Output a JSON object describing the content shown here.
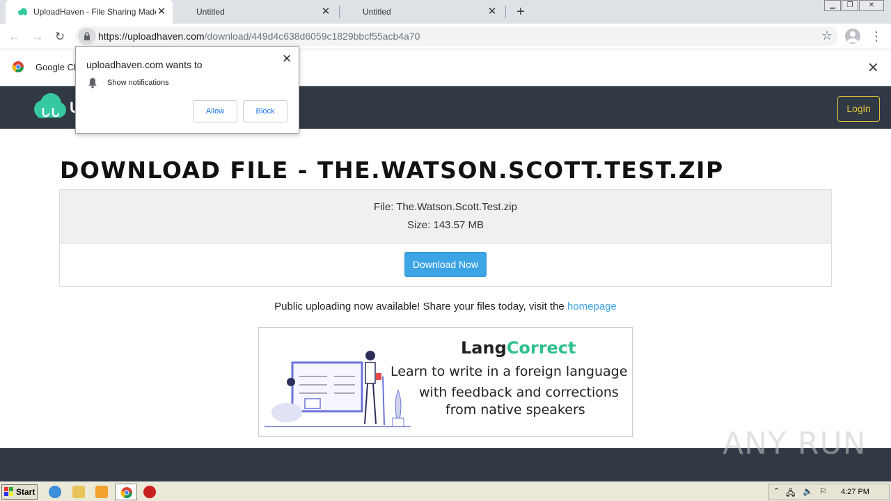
{
  "browser": {
    "tabs": [
      {
        "title": "UploadHaven - File Sharing Made Sim",
        "active": true
      },
      {
        "title": "Untitled",
        "active": false
      },
      {
        "title": "Untitled",
        "active": false
      }
    ],
    "url_host": "https://uploadhaven.com",
    "url_path": "/download/449d4c638d6059c1829bbcf55acb4a70",
    "infobar_text": "Google Ch"
  },
  "popup": {
    "title": "uploadhaven.com wants to",
    "permission": "Show notifications",
    "allow_label": "Allow",
    "block_label": "Block"
  },
  "site": {
    "logo_text": "U",
    "nav_fragment": "s",
    "login_label": "Login",
    "accent_color": "#3da4e6"
  },
  "download": {
    "heading": "DOWNLOAD FILE - THE.WATSON.SCOTT.TEST.ZIP",
    "file_line": "File: The.Watson.Scott.Test.zip",
    "size_line": "Size: 143.57 MB",
    "button_label": "Download Now",
    "public_text": "Public uploading now available! Share your files today, visit the ",
    "homepage_link": "homepage"
  },
  "ad": {
    "brand_part1": "Lang",
    "brand_part2": "Correct",
    "line1": "Learn to write in a foreign language",
    "line2": "with feedback and corrections",
    "line3": "from native speakers"
  },
  "watermark": "ANY RUN",
  "taskbar": {
    "start_label": "Start",
    "clock": "4:27 PM"
  }
}
